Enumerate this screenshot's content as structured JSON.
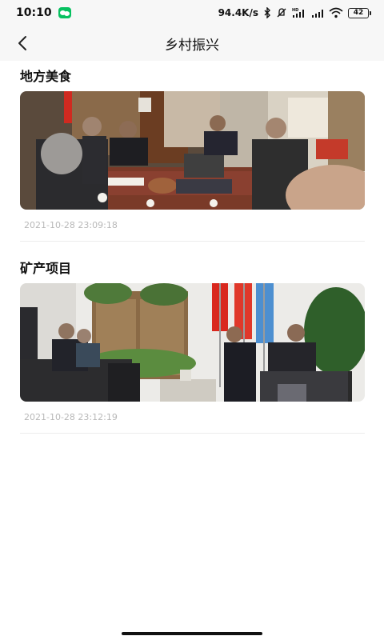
{
  "status_bar": {
    "time": "10:10",
    "network_speed": "94.4K/s",
    "network_type": "HD",
    "battery": "42",
    "icons": [
      "wechat-icon",
      "bluetooth-icon",
      "mute-icon",
      "signal-icon",
      "signal-icon",
      "wifi-icon",
      "battery-icon"
    ]
  },
  "nav": {
    "title": "乡村振兴",
    "back_icon": "chevron-left-icon"
  },
  "articles": [
    {
      "title": "地方美食",
      "date": "2021-10-28 23:09:18",
      "image": "meeting-photo"
    },
    {
      "title": "矿产项目",
      "date": "2021-10-28 23:12:19",
      "image": "meeting-photo"
    }
  ],
  "colors": {
    "background": "#ffffff",
    "header_bg": "#f7f7f7",
    "date_text": "#b8b8b8",
    "divider": "#ececec"
  }
}
